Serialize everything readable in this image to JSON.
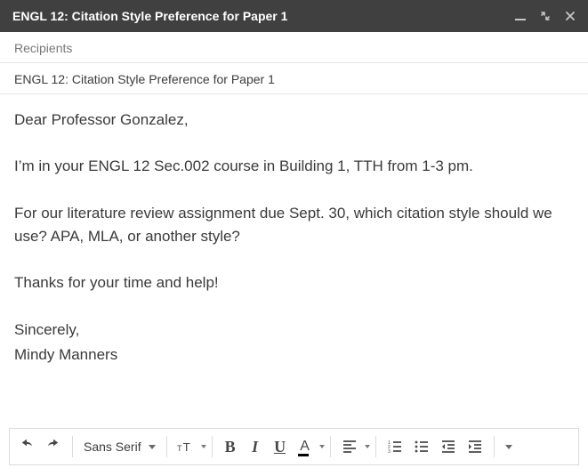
{
  "window": {
    "title": "ENGL 12: Citation Style Preference for Paper 1"
  },
  "header": {
    "recipients_placeholder": "Recipients",
    "subject": "ENGL 12: Citation Style Preference for Paper 1"
  },
  "body": {
    "p1": "Dear Professor Gonzalez,",
    "p2": "I’m in your ENGL 12 Sec.002 course in Building 1, TTH from 1-3 pm.",
    "p3": "For our literature review assignment due Sept. 30, which citation style should we use? APA, MLA, or another style?",
    "p4": "Thanks for your time and help!",
    "p5": "Sincerely,",
    "p6": "Mindy Manners"
  },
  "toolbar": {
    "font_family": "Sans Serif",
    "bold": "B",
    "italic": "I",
    "underline": "U",
    "color": "A"
  }
}
